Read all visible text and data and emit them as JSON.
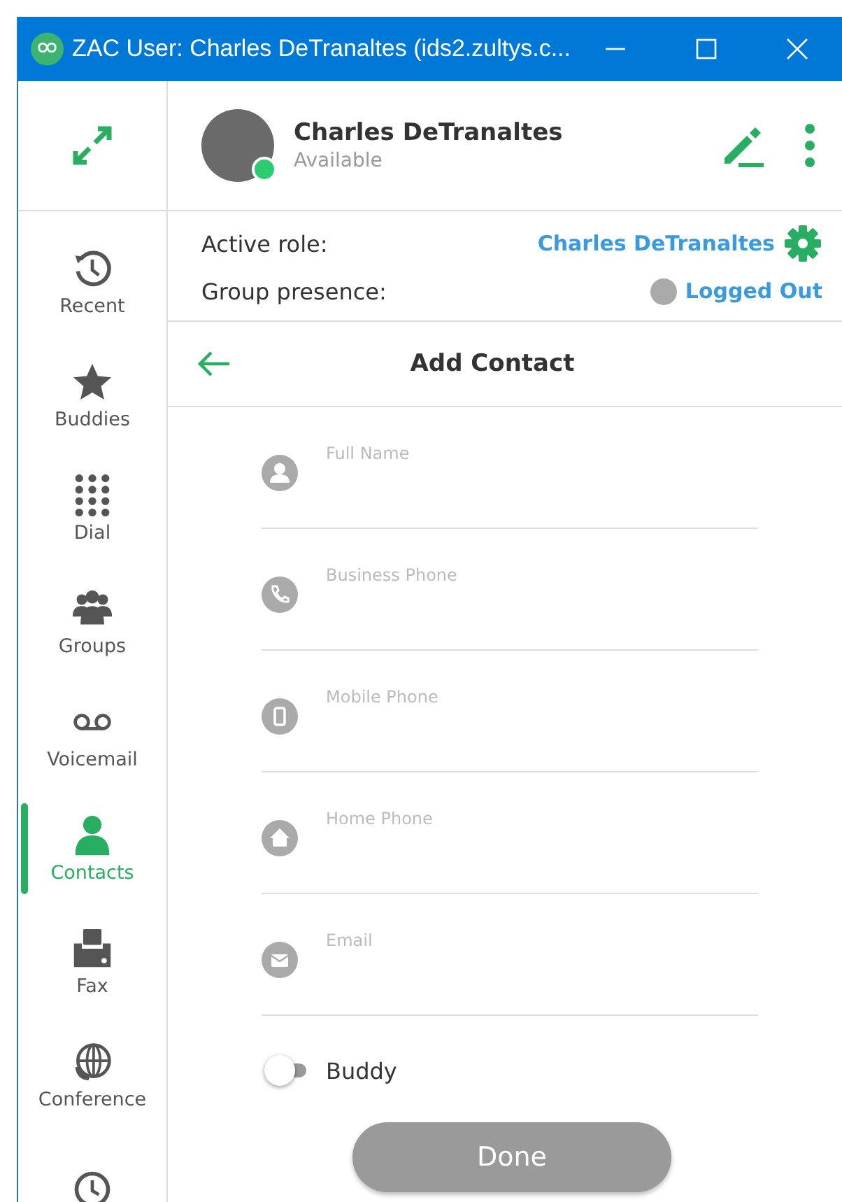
{
  "window": {
    "title": "ZAC User: Charles DeTranaltes (ids2.zultys.c..."
  },
  "user": {
    "name": "Charles DeTranaltes",
    "status": "Available",
    "online": true
  },
  "role": {
    "label": "Active role:",
    "value": "Charles DeTranaltes"
  },
  "presence": {
    "label": "Group presence:",
    "value": "Logged Out"
  },
  "sidebar": {
    "items": [
      {
        "kind": "recent",
        "label": "Recent",
        "selected": false
      },
      {
        "kind": "star",
        "label": "Buddies",
        "selected": false
      },
      {
        "kind": "dial",
        "label": "Dial",
        "selected": false
      },
      {
        "kind": "groups",
        "label": "Groups",
        "selected": false
      },
      {
        "kind": "voicemail",
        "label": "Voicemail",
        "selected": false
      },
      {
        "kind": "contacts",
        "label": "Contacts",
        "selected": true
      },
      {
        "kind": "fax",
        "label": "Fax",
        "selected": false
      },
      {
        "kind": "conference",
        "label": "Conference",
        "selected": false
      },
      {
        "kind": "clock",
        "selected": false
      }
    ]
  },
  "page": {
    "title": "Add Contact"
  },
  "fields": [
    {
      "kind": "person",
      "placeholder": "Full Name"
    },
    {
      "kind": "phone",
      "placeholder": "Business Phone"
    },
    {
      "kind": "mobile",
      "placeholder": "Mobile Phone"
    },
    {
      "kind": "home",
      "placeholder": "Home Phone"
    },
    {
      "kind": "email",
      "placeholder": "Email"
    }
  ],
  "buddy": {
    "label": "Buddy",
    "on": false
  },
  "done": {
    "label": "Done",
    "disabled": true
  }
}
